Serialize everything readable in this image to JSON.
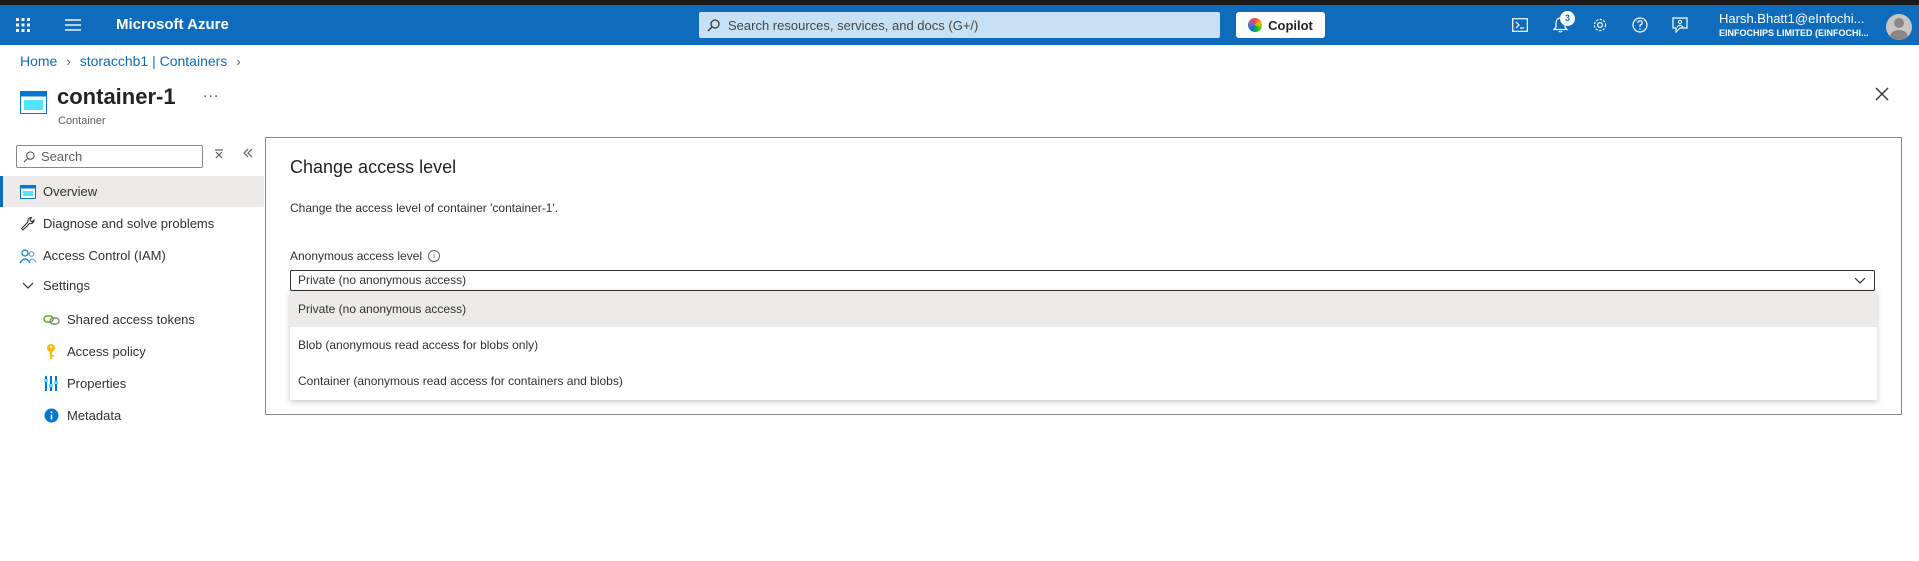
{
  "topbar": {
    "brand": "Microsoft Azure",
    "search_placeholder": "Search resources, services, and docs (G+/)",
    "copilot_label": "Copilot",
    "notification_count": "3",
    "user_name": "Harsh.Bhatt1@eInfochi...",
    "user_org": "EINFOCHIPS LIMITED (EINFOCHI...",
    "accent": "#0f6cbd"
  },
  "breadcrumb": {
    "home": "Home",
    "parent": "storacchb1 | Containers"
  },
  "resource": {
    "title": "container-1",
    "more": "...",
    "subtitle": "Container"
  },
  "sidebar": {
    "search_placeholder": "Search",
    "items": [
      {
        "label": "Overview",
        "icon": "container-icon"
      },
      {
        "label": "Diagnose and solve problems",
        "icon": "wrench-icon"
      },
      {
        "label": "Access Control (IAM)",
        "icon": "people-icon"
      },
      {
        "label": "Settings",
        "icon": "chevron-down-icon"
      },
      {
        "label": "Shared access tokens",
        "icon": "link-icon"
      },
      {
        "label": "Access policy",
        "icon": "key-icon"
      },
      {
        "label": "Properties",
        "icon": "properties-icon"
      },
      {
        "label": "Metadata",
        "icon": "info-icon"
      }
    ]
  },
  "panel": {
    "title": "Change access level",
    "description": "Change the access level of container 'container-1'.",
    "field_label": "Anonymous access level",
    "selected_value": "Private (no anonymous access)",
    "options": [
      "Private (no anonymous access)",
      "Blob (anonymous read access for blobs only)",
      "Container (anonymous read access for containers and blobs)"
    ]
  }
}
